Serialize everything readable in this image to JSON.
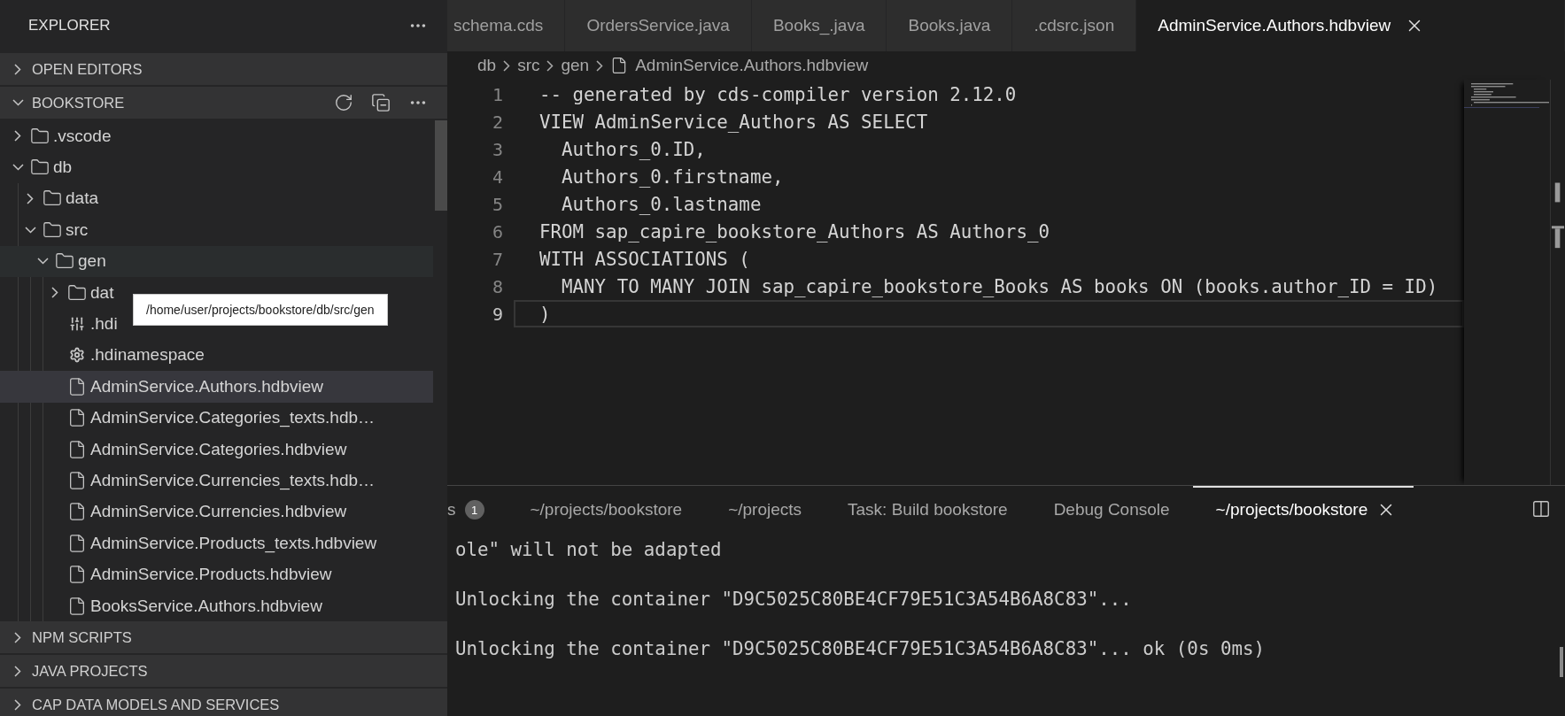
{
  "explorer": {
    "title": "EXPLORER"
  },
  "sections_top": [
    {
      "label": "OPEN EDITORS",
      "expanded": false
    }
  ],
  "workspace": {
    "label": "BOOKSTORE",
    "expanded": true,
    "tree": [
      {
        "kind": "folder",
        "name": ".vscode",
        "expanded": false,
        "selected": false
      },
      {
        "kind": "folder",
        "name": "db",
        "expanded": true,
        "selected": false,
        "children": [
          {
            "kind": "folder",
            "name": "data",
            "expanded": false,
            "selected": false
          },
          {
            "kind": "folder",
            "name": "src",
            "expanded": true,
            "selected": false,
            "children": [
              {
                "kind": "folder",
                "name": "gen",
                "expanded": true,
                "selected": false,
                "tooltip": "/home/user/projects/bookstore/db/src/gen",
                "children": [
                  {
                    "kind": "folder",
                    "name": "dat",
                    "expanded": false,
                    "selected": false
                  },
                  {
                    "kind": "config",
                    "name": ".hdi",
                    "selected": false
                  },
                  {
                    "kind": "settings",
                    "name": ".hdinamespace",
                    "selected": false
                  },
                  {
                    "kind": "file",
                    "name": "AdminService.Authors.hdbview",
                    "selected": true
                  },
                  {
                    "kind": "file",
                    "name": "AdminService.Categories_texts.hdb…",
                    "selected": false
                  },
                  {
                    "kind": "file",
                    "name": "AdminService.Categories.hdbview",
                    "selected": false
                  },
                  {
                    "kind": "file",
                    "name": "AdminService.Currencies_texts.hdb…",
                    "selected": false
                  },
                  {
                    "kind": "file",
                    "name": "AdminService.Currencies.hdbview",
                    "selected": false
                  },
                  {
                    "kind": "file",
                    "name": "AdminService.Products_texts.hdbview",
                    "selected": false
                  },
                  {
                    "kind": "file",
                    "name": "AdminService.Products.hdbview",
                    "selected": false
                  },
                  {
                    "kind": "file",
                    "name": "BooksService.Authors.hdbview",
                    "selected": false
                  }
                ]
              }
            ]
          }
        ]
      }
    ]
  },
  "sections_bottom": [
    {
      "label": "NPM SCRIPTS",
      "expanded": false
    },
    {
      "label": "JAVA PROJECTS",
      "expanded": false
    },
    {
      "label": "CAP DATA MODELS AND SERVICES",
      "expanded": false
    }
  ],
  "tabs": [
    {
      "label": "schema.cds",
      "selected": false
    },
    {
      "label": "OrdersService.java",
      "selected": false
    },
    {
      "label": "Books_.java",
      "selected": false
    },
    {
      "label": "Books.java",
      "selected": false
    },
    {
      "label": ".cdsrc.json",
      "selected": false
    },
    {
      "label": "AdminService.Authors.hdbview",
      "selected": true
    }
  ],
  "breadcrumb": [
    {
      "kind": "folder",
      "label": "db"
    },
    {
      "kind": "folder",
      "label": "src"
    },
    {
      "kind": "folder",
      "label": "gen"
    },
    {
      "kind": "file",
      "label": "AdminService.Authors.hdbview"
    }
  ],
  "code_lines": [
    {
      "number": "1",
      "text": "-- generated by cds-compiler version 2.12.0",
      "current": false
    },
    {
      "number": "2",
      "text": "VIEW AdminService_Authors AS SELECT",
      "current": false
    },
    {
      "number": "3",
      "text": "  Authors_0.ID,",
      "current": false
    },
    {
      "number": "4",
      "text": "  Authors_0.firstname,",
      "current": false
    },
    {
      "number": "5",
      "text": "  Authors_0.lastname",
      "current": false
    },
    {
      "number": "6",
      "text": "FROM sap_capire_bookstore_Authors AS Authors_0",
      "current": false
    },
    {
      "number": "7",
      "text": "WITH ASSOCIATIONS (",
      "current": false
    },
    {
      "number": "8",
      "text": "  MANY TO MANY JOIN sap_capire_bookstore_Books AS books ON (books.author_ID = ID)",
      "current": false
    },
    {
      "number": "9",
      "text": ")",
      "current": true
    }
  ],
  "panel_tabs": [
    {
      "label": "s",
      "badge": "1",
      "selected": false
    },
    {
      "label": "~/projects/bookstore",
      "selected": false
    },
    {
      "label": "~/projects",
      "selected": false
    },
    {
      "label": "Task: Build bookstore",
      "selected": false
    },
    {
      "label": "Debug Console",
      "selected": false
    },
    {
      "label": "~/projects/bookstore",
      "selected": true
    }
  ],
  "terminal_lines": [
    "ole\" will not be adapted",
    "Unlocking the container \"D9C5025C80BE4CF79E51C3A54B6A8C83\"...",
    "Unlocking the container \"D9C5025C80BE4CF79E51C3A54B6A8C83\"... ok (0s 0ms)"
  ]
}
